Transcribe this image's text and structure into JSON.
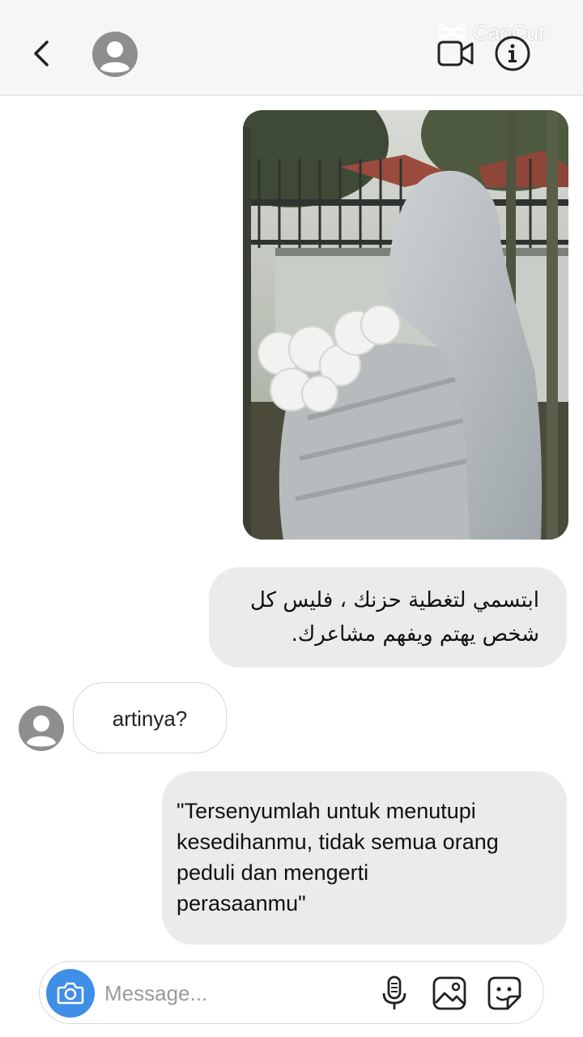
{
  "watermark": {
    "text": "CapCut"
  },
  "header": {
    "back_icon": "chevron-left-icon",
    "avatar_icon": "default-avatar-icon",
    "video_icon": "video-call-icon",
    "info_icon": "info-icon"
  },
  "messages": {
    "photo": {
      "icon": "photo-message",
      "description_colors": [
        "#4a5040",
        "#c6cacb",
        "#f2f2f0"
      ]
    },
    "arabic": {
      "line1": "ابتسمي لتغطية حزنك ، فليس كل",
      "line2": "شخص يهتم ويفهم مشاعرك."
    },
    "received": {
      "text": "artinya?"
    },
    "translation": {
      "line1": "\"Tersenyumlah untuk menutupi",
      "line2": "kesedihanmu, tidak semua orang",
      "line3": "peduli dan mengerti",
      "line4": "perasaanmu\""
    }
  },
  "composer": {
    "placeholder": "Message...",
    "camera_icon": "camera-icon",
    "mic_icon": "microphone-icon",
    "gallery_icon": "gallery-icon",
    "sticker_icon": "sticker-icon"
  },
  "colors": {
    "accent": "#3f8ee8",
    "sent_bubble": "#ebebeb",
    "header_bg": "#f6f6f6"
  }
}
